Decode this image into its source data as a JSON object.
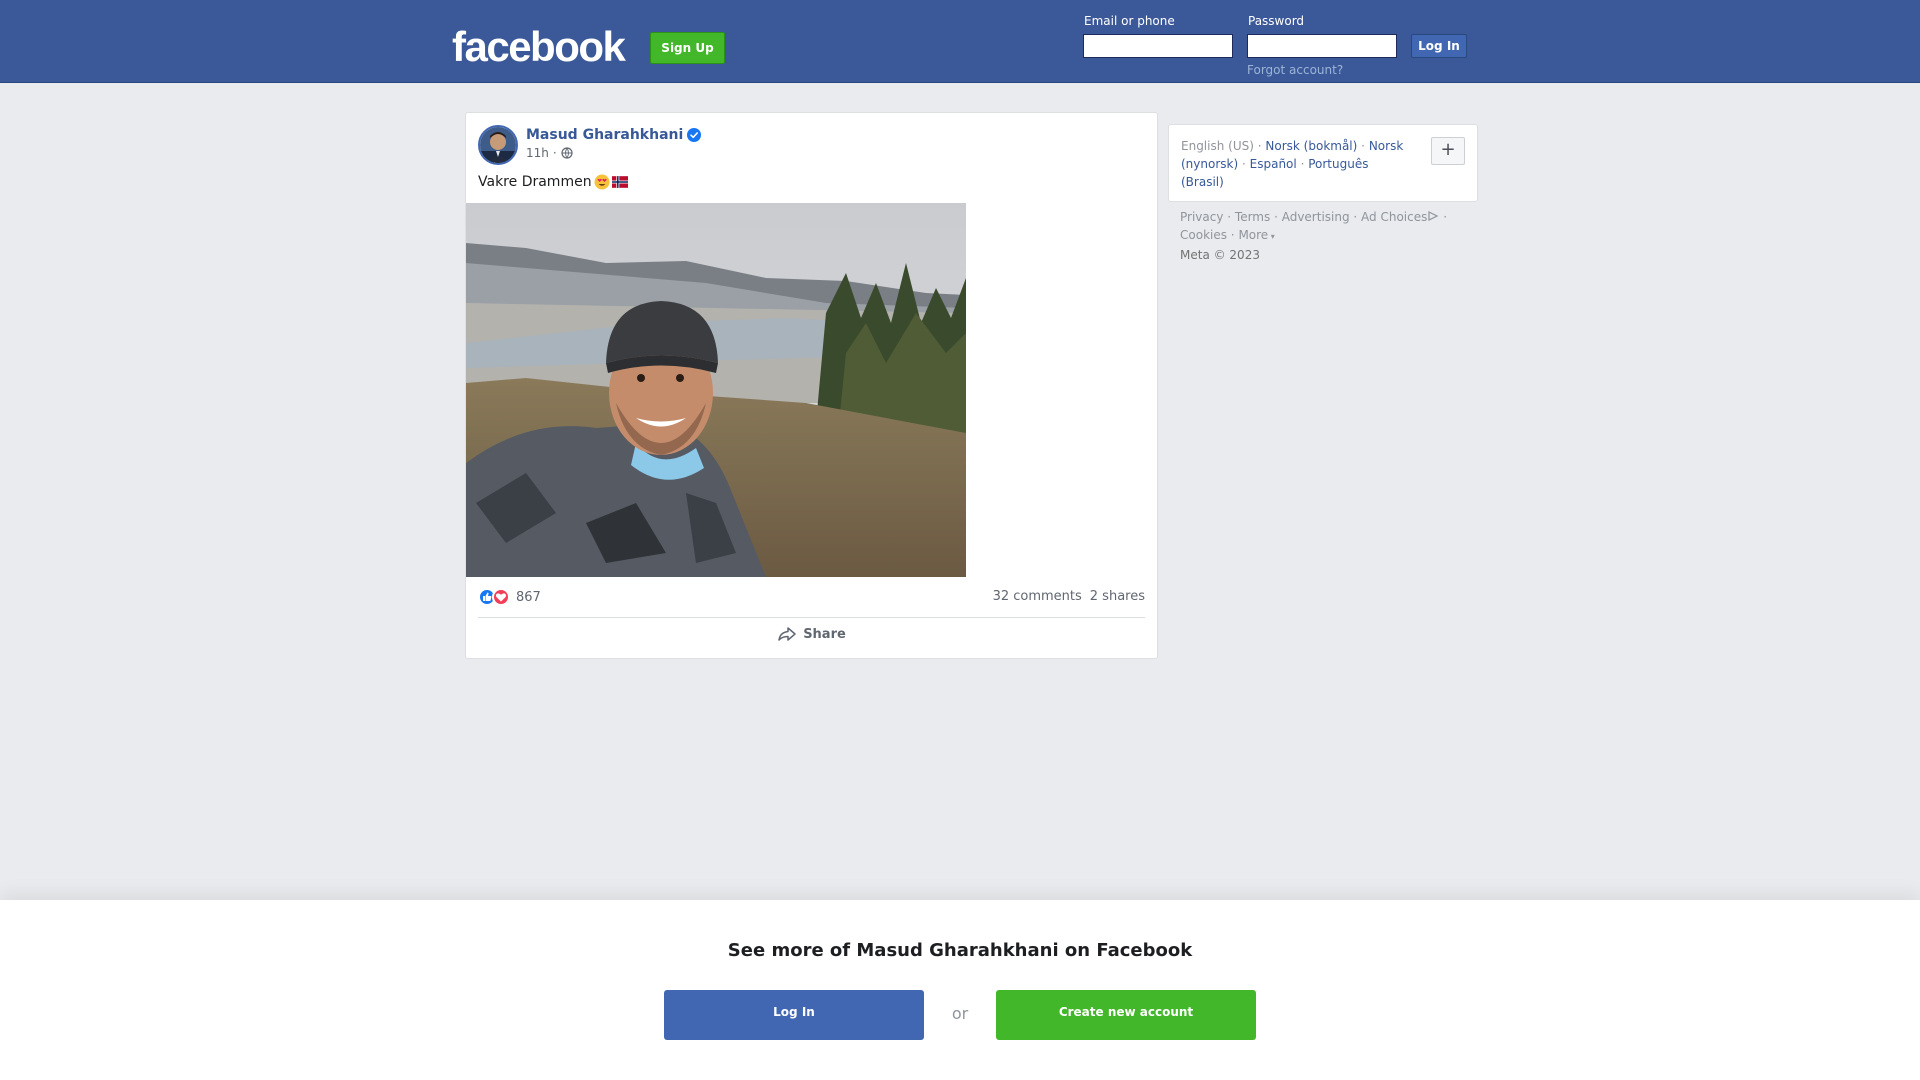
{
  "header": {
    "logo_text": "facebook",
    "signup_label": "Sign Up",
    "email_label": "Email or phone",
    "email_value": "",
    "password_label": "Password",
    "password_value": "",
    "login_label": "Log In",
    "forgot_label": "Forgot account?"
  },
  "post": {
    "author": "Masud Gharahkhani",
    "verified": true,
    "time": "11h",
    "audience_icon": "globe-icon",
    "caption": "Vakre Drammen",
    "caption_emojis": [
      "heart-eyes-emoji",
      "norway-flag-emoji"
    ],
    "reaction_icons": [
      "like-reaction-icon",
      "love-reaction-icon"
    ],
    "reaction_count": "867",
    "comments": "32 comments",
    "shares": "2 shares",
    "share_label": "Share"
  },
  "languages": {
    "current": "English (US)",
    "others": [
      "Norsk (bokmål)",
      "Norsk (nynorsk)",
      "Español",
      "Português (Brasil)"
    ],
    "more_button": "+"
  },
  "footer": {
    "links": [
      "Privacy",
      "Terms",
      "Advertising",
      "Ad Choices",
      "Cookies",
      "More"
    ],
    "copyright": "Meta © 2023"
  },
  "overlay": {
    "title": "See more of Masud Gharahkhani on Facebook",
    "login_label": "Log In",
    "or_label": "or",
    "create_label": "Create new account"
  },
  "colors": {
    "brand_blue": "#3b5998",
    "button_blue": "#4267b2",
    "green": "#42b72a",
    "link": "#385898"
  }
}
